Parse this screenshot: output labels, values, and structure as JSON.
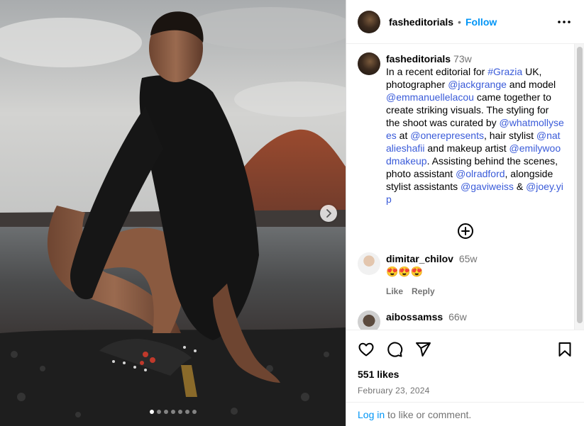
{
  "colors": {
    "accent": "#0095f6",
    "mention": "#3a5bd9",
    "secondary_text": "#737373",
    "border": "#dbdbdb"
  },
  "carousel": {
    "image_description": "Model crouching on volcanic rocky shore beside water with a red volcano behind, wearing black crochet top and embellished heeled sandals",
    "dot_count": 7,
    "active_dot": 0
  },
  "header": {
    "username": "fasheditorials",
    "separator": "•",
    "follow_label": "Follow",
    "more_icon": "more-horizontal-icon"
  },
  "caption": {
    "username": "fasheditorials",
    "time": "73w",
    "parts": [
      {
        "t": "In a recent editorial for ",
        "link": false
      },
      {
        "t": "#Grazia",
        "link": true
      },
      {
        "t": " UK, photographer ",
        "link": false
      },
      {
        "t": "@jackgrange",
        "link": true
      },
      {
        "t": " and model ",
        "link": false
      },
      {
        "t": "@emmanuellelacou",
        "link": true
      },
      {
        "t": " came together to create striking visuals. The styling for the shoot was curated by ",
        "link": false
      },
      {
        "t": "@whatmollysees",
        "link": true
      },
      {
        "t": " at ",
        "link": false
      },
      {
        "t": "@onerepresents",
        "link": true
      },
      {
        "t": ", hair stylist ",
        "link": false
      },
      {
        "t": "@natalieshafii",
        "link": true
      },
      {
        "t": " and makeup artist ",
        "link": false
      },
      {
        "t": "@emilywoodmakeup",
        "link": true
      },
      {
        "t": ". Assisting behind the scenes, photo assistant ",
        "link": false
      },
      {
        "t": "@olradford",
        "link": true
      },
      {
        "t": ", alongside stylist assistants ",
        "link": false
      },
      {
        "t": "@gaviweiss",
        "link": true
      },
      {
        "t": " & ",
        "link": false
      },
      {
        "t": "@joey.yip",
        "link": true
      }
    ]
  },
  "load_more_icon": "plus-circle-icon",
  "comments": [
    {
      "username": "dimitar_chilov",
      "time": "65w",
      "text": "😍😍😍",
      "like_label": "Like",
      "reply_label": "Reply"
    },
    {
      "username": "aibossamss",
      "time": "66w",
      "text": "",
      "like_label": "",
      "reply_label": ""
    }
  ],
  "footer": {
    "likes": "551 likes",
    "date": "February 23, 2024",
    "login_link": "Log in",
    "login_rest": " to like or comment.",
    "icons": [
      "heart-icon",
      "comment-icon",
      "share-icon",
      "bookmark-icon"
    ]
  }
}
